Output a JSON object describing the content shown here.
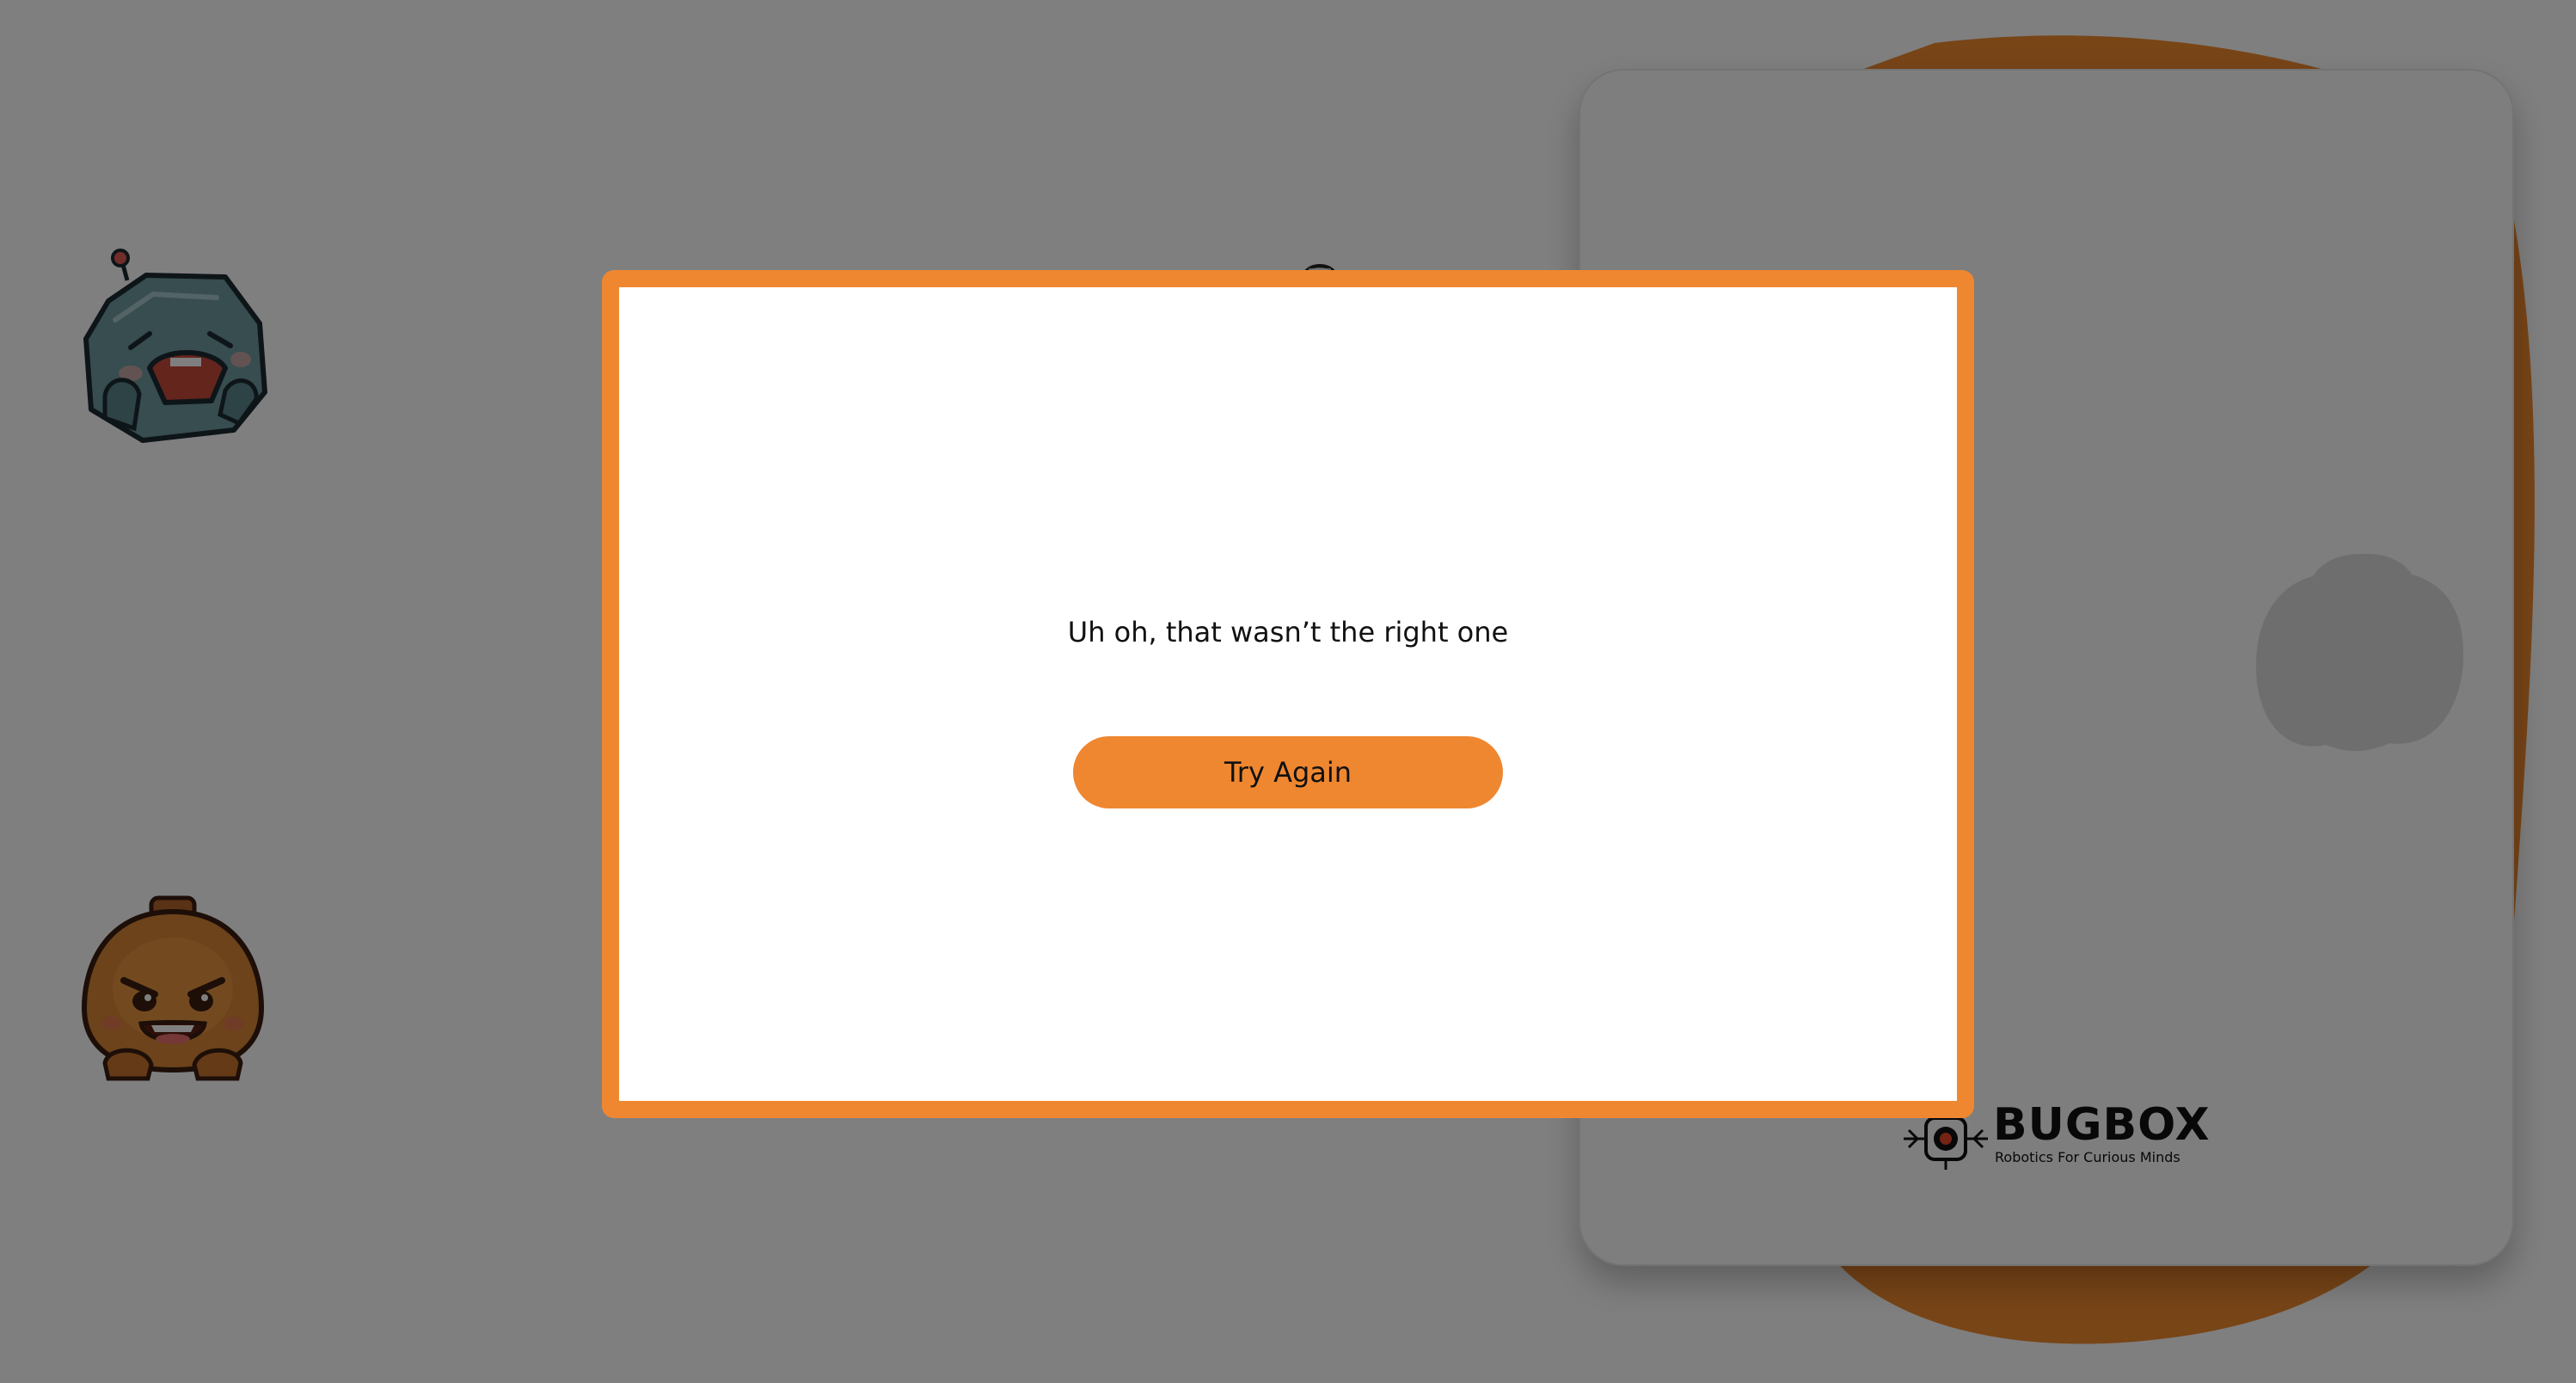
{
  "modal": {
    "message": "Uh oh, that wasn’t the right one",
    "button_label": "Try Again"
  },
  "brand": {
    "name": "BUGBOX",
    "tagline": "Robotics For Curious Minds"
  },
  "icons": {
    "teal_robot": "laughing-teal-robot-icon",
    "orange_robot": "grinning-orange-robot-icon",
    "card_target": "robot-silhouette-icon",
    "peeking_robot": "peeking-robot-antenna-icon",
    "logo": "bugbox-logo-icon"
  },
  "colors": {
    "accent": "#ef8731",
    "overlay": "rgba(0,0,0,0.5)",
    "modal_background": "#ffffff",
    "text": "#111111"
  }
}
